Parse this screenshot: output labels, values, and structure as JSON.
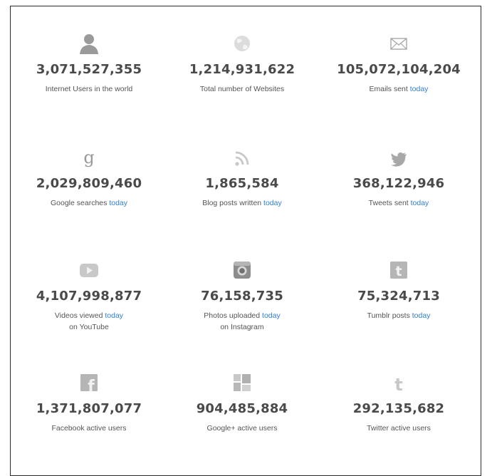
{
  "stats": [
    {
      "value": "3,071,527,355",
      "label": "Internet Users in the world",
      "today": "",
      "line2": "",
      "icon": "user-icon"
    },
    {
      "value": "1,214,931,622",
      "label": "Total number of Websites",
      "today": "",
      "line2": "",
      "icon": "globe-icon"
    },
    {
      "value": "105,072,104,204",
      "label": "Emails sent",
      "today": "today",
      "line2": "",
      "icon": "envelope-icon"
    },
    {
      "value": "2,029,809,460",
      "label": "Google searches",
      "today": "today",
      "line2": "",
      "icon": "google-icon"
    },
    {
      "value": "1,865,584",
      "label": "Blog posts written",
      "today": "today",
      "line2": "",
      "icon": "rss-icon"
    },
    {
      "value": "368,122,946",
      "label": "Tweets sent",
      "today": "today",
      "line2": "",
      "icon": "twitter-bird-icon"
    },
    {
      "value": "4,107,998,877",
      "label": "Videos viewed",
      "today": "today",
      "line2": "on YouTube",
      "icon": "youtube-icon"
    },
    {
      "value": "76,158,735",
      "label": "Photos uploaded",
      "today": "today",
      "line2": "on Instagram",
      "icon": "instagram-icon"
    },
    {
      "value": "75,324,713",
      "label": "Tumblr posts",
      "today": "today",
      "line2": "",
      "icon": "tumblr-icon"
    },
    {
      "value": "1,371,807,077",
      "label": "Facebook active users",
      "today": "",
      "line2": "",
      "icon": "facebook-icon"
    },
    {
      "value": "904,485,884",
      "label": "Google+ active users",
      "today": "",
      "line2": "",
      "icon": "google-plus-icon"
    },
    {
      "value": "292,135,682",
      "label": "Twitter active users",
      "today": "",
      "line2": "",
      "icon": "twitter-t-icon"
    }
  ],
  "colors": {
    "number": "#4a4a4a",
    "label": "#555555",
    "today": "#2f7fd1",
    "icon": "#9a9a9a"
  }
}
